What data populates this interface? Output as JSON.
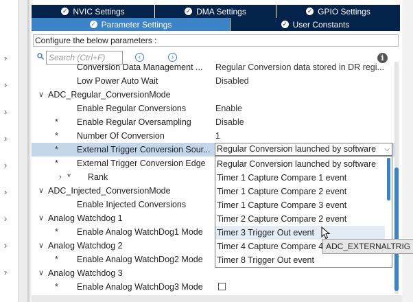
{
  "tabs_row1": [
    {
      "label": "NVIC Settings",
      "active": false
    },
    {
      "label": "DMA Settings",
      "active": false
    },
    {
      "label": "GPIO Settings",
      "active": false
    }
  ],
  "tabs_row2": [
    {
      "label": "Parameter Settings",
      "active": true
    },
    {
      "label": "User Constants",
      "active": false
    }
  ],
  "configure_label": "Configure the below parameters :",
  "search": {
    "placeholder": "Search (Ctrl+F)"
  },
  "params": [
    {
      "name": "Conversion Data Management ...",
      "value": "Regular Conversion data stored in DR regi...",
      "star": false,
      "chevron": "",
      "indent": 2
    },
    {
      "name": "Low Power Auto Wait",
      "value": "Disabled",
      "star": false,
      "chevron": "",
      "indent": 2
    },
    {
      "name": "ADC_Regular_ConversionMode",
      "value": "",
      "star": false,
      "chevron": "down",
      "indent": 0
    },
    {
      "name": "Enable Regular Conversions",
      "value": "Enable",
      "star": false,
      "chevron": "",
      "indent": 2
    },
    {
      "name": "Enable Regular Oversampling",
      "value": "Disable",
      "star": true,
      "chevron": "",
      "indent": 1
    },
    {
      "name": "Number Of Conversion",
      "value": "1",
      "star": true,
      "chevron": "",
      "indent": 1
    },
    {
      "name": "External Trigger Conversion Sour...",
      "value": "",
      "star": true,
      "chevron": "",
      "indent": 1,
      "selected": true
    },
    {
      "name": "External Trigger Conversion Edge",
      "value": "",
      "star": true,
      "chevron": "",
      "indent": 1
    },
    {
      "name": "Rank",
      "value": "",
      "star": true,
      "chevron": "right",
      "indent": 3
    },
    {
      "name": "ADC_Injected_ConversionMode",
      "value": "",
      "star": false,
      "chevron": "down",
      "indent": 0
    },
    {
      "name": "Enable Injected Conversions",
      "value": "",
      "star": false,
      "chevron": "",
      "indent": 2
    },
    {
      "name": "Analog Watchdog 1",
      "value": "",
      "star": false,
      "chevron": "down",
      "indent": 0
    },
    {
      "name": "Enable Analog WatchDog1 Mode",
      "value": "",
      "star": true,
      "chevron": "",
      "indent": 1
    },
    {
      "name": "Analog Watchdog 2",
      "value": "",
      "star": false,
      "chevron": "down",
      "indent": 0
    },
    {
      "name": "Enable Analog WatchDog2 Mode",
      "value": "",
      "star": true,
      "chevron": "",
      "indent": 1
    },
    {
      "name": "Analog Watchdog 3",
      "value": "",
      "star": false,
      "chevron": "down",
      "indent": 0
    },
    {
      "name": "Enable Analog WatchDog3 Mode",
      "value": "",
      "star": true,
      "chevron": "",
      "indent": 1,
      "checkbox": true
    }
  ],
  "combo_value": "Regular Conversion launched by software",
  "dropdown_options": [
    "Regular Conversion launched by software",
    "Timer 1 Capture Compare 1 event",
    "Timer 1 Capture Compare 2 event",
    "Timer 1 Capture Compare 3 event",
    "Timer 2 Capture Compare 2 event",
    "Timer 3 Trigger Out event",
    "Timer 4 Capture Compare 4 event",
    "Timer 8 Trigger Out event"
  ],
  "dropdown_hover_index": 5,
  "tooltip": "ADC_EXTERNALTRIG",
  "colors": {
    "tab_dark": "#03234b",
    "tab_active": "#3c82c6",
    "row_selected": "#c3d6ea"
  },
  "icons": {
    "tab_check": "check-circle-icon",
    "search": "search-icon",
    "prev": "arrow-left-circle-icon",
    "next": "arrow-right-circle-icon",
    "info": "info-icon",
    "dropdown": "chevron-down-icon"
  }
}
